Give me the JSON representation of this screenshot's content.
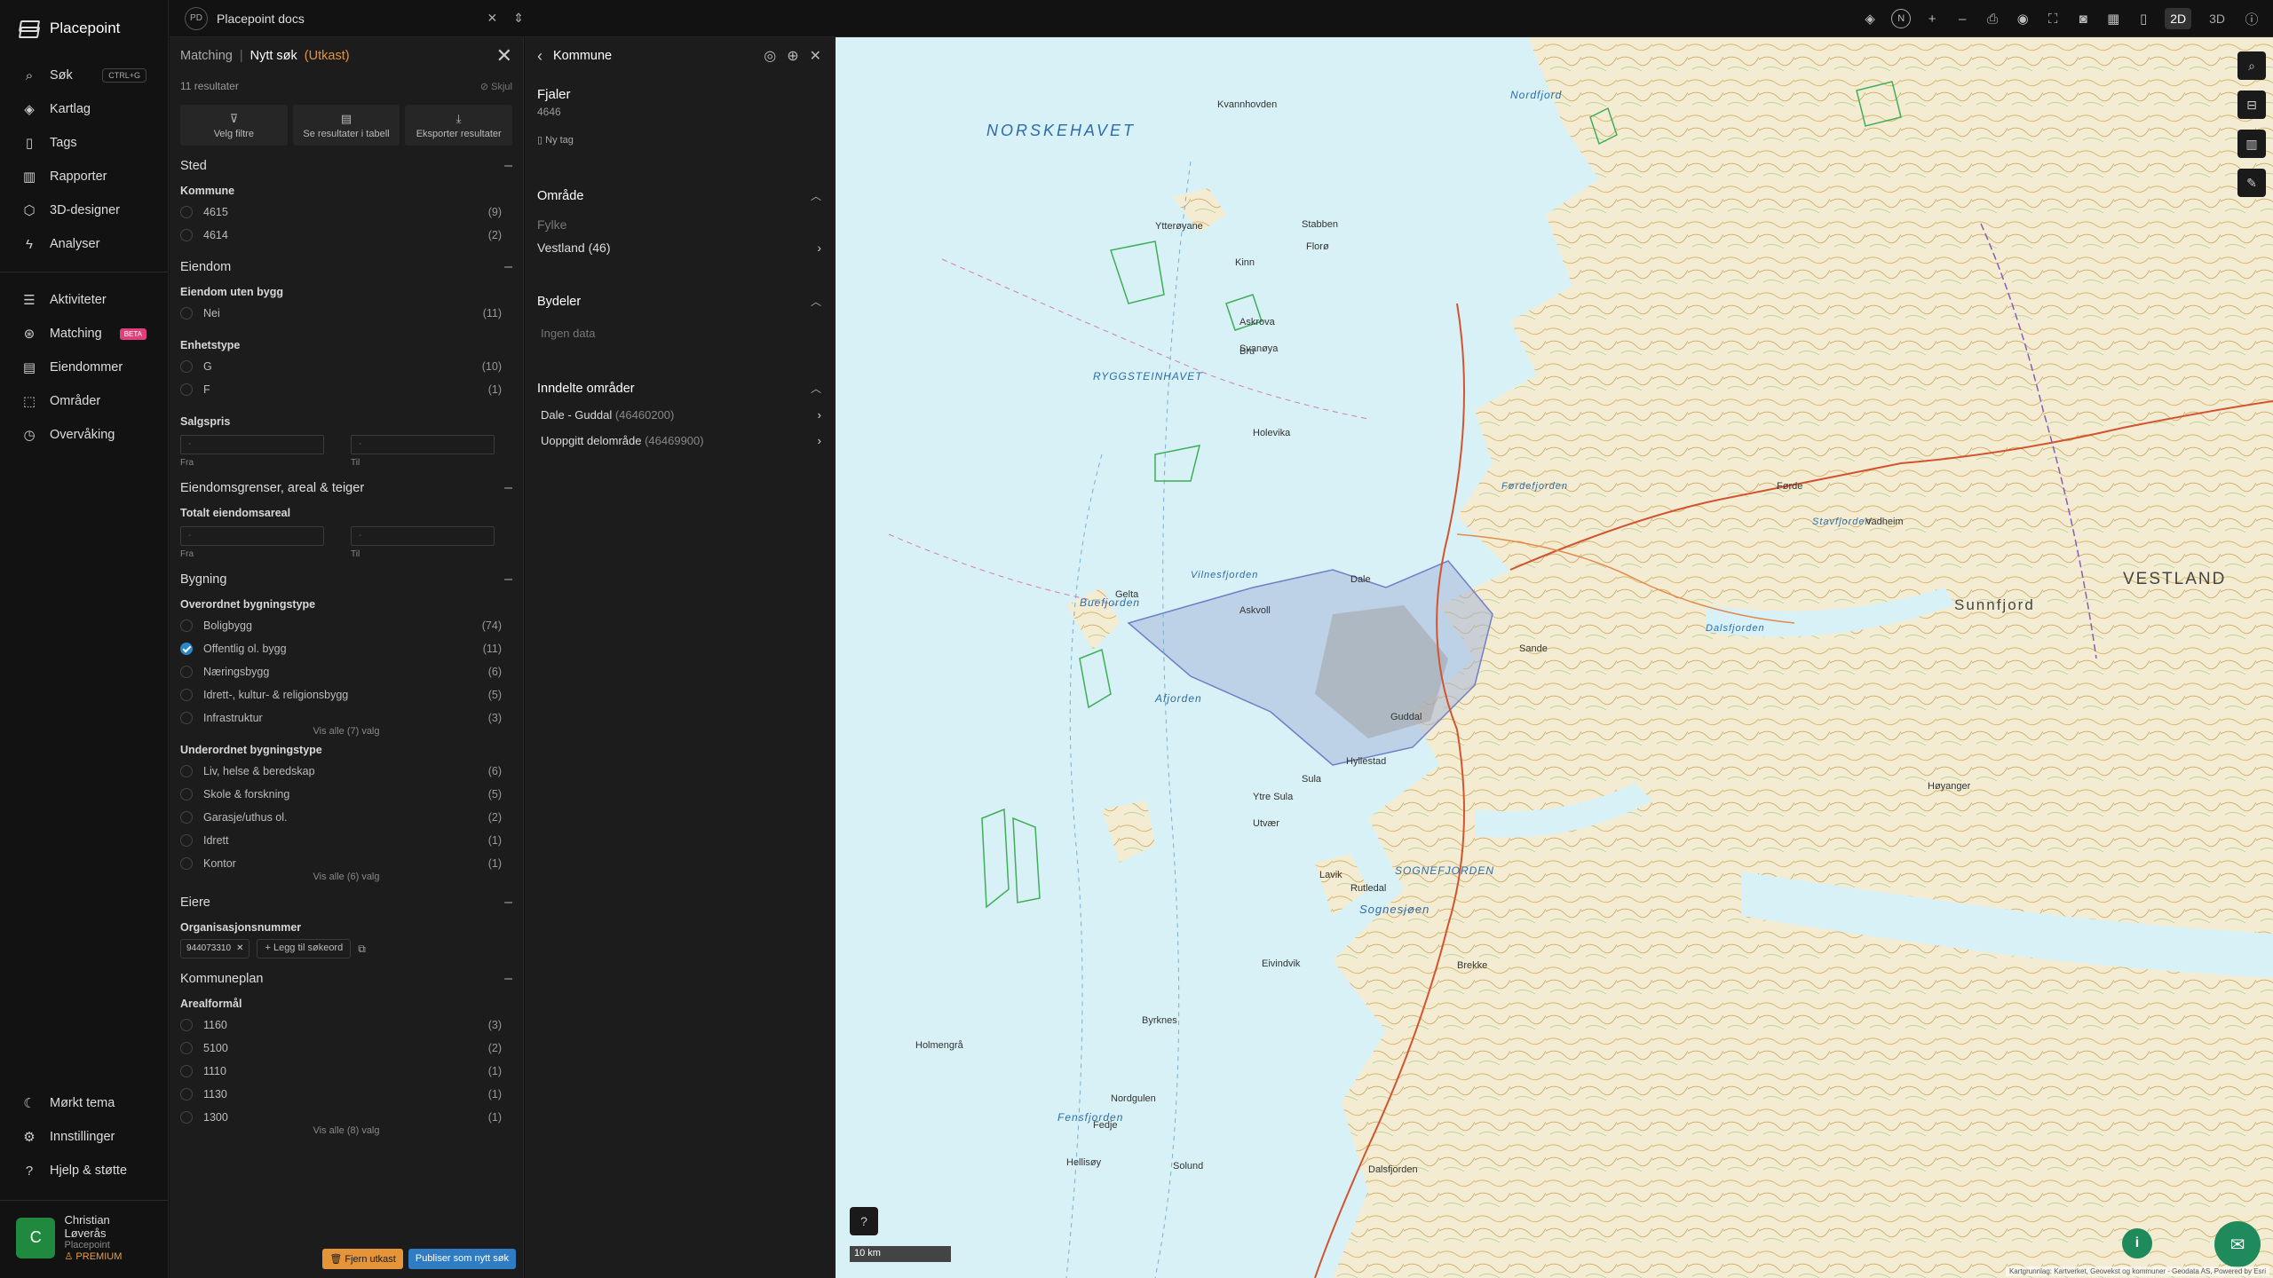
{
  "app": {
    "brand": "Placepoint",
    "project_badge": "PD",
    "project_name": "Placepoint docs"
  },
  "nav": {
    "items": [
      {
        "label": "Søk",
        "icon": "search-icon",
        "shortcut": "CTRL+G"
      },
      {
        "label": "Kartlag",
        "icon": "layers-icon"
      },
      {
        "label": "Tags",
        "icon": "bookmark-icon"
      },
      {
        "label": "Rapporter",
        "icon": "chart-icon"
      },
      {
        "label": "3D-designer",
        "icon": "cube-icon"
      },
      {
        "label": "Analyser",
        "icon": "bolt-icon"
      }
    ],
    "items2": [
      {
        "label": "Aktiviteter",
        "icon": "activity-icon"
      },
      {
        "label": "Matching",
        "icon": "matching-icon",
        "badge": "BETA"
      },
      {
        "label": "Eiendommer",
        "icon": "building-icon"
      },
      {
        "label": "Områder",
        "icon": "area-icon"
      },
      {
        "label": "Overvåking",
        "icon": "monitor-icon"
      }
    ],
    "bottom": [
      {
        "label": "Mørkt tema",
        "icon": "moon-icon"
      },
      {
        "label": "Innstillinger",
        "icon": "gear-icon"
      },
      {
        "label": "Hjelp & støtte",
        "icon": "help-icon"
      }
    ],
    "user": {
      "initial": "C",
      "name": "Christian Løverås",
      "org": "Placepoint",
      "tier": "PREMIUM"
    }
  },
  "topbar": {
    "compass": "N",
    "mode_2d": "2D",
    "mode_3d": "3D"
  },
  "filters": {
    "crumb": "Matching",
    "title": "Nytt søk",
    "draft": "(Utkast)",
    "results": "11 resultater",
    "hide": "Skjul",
    "actions": [
      "Velg filtre",
      "Se resultater i tabell",
      "Eksporter resultater"
    ],
    "sted": {
      "title": "Sted",
      "kommune_label": "Kommune",
      "options": [
        {
          "label": "4615",
          "count": "(9)"
        },
        {
          "label": "4614",
          "count": "(2)"
        }
      ]
    },
    "eiendom": {
      "title": "Eiendom",
      "uten_bygg_label": "Eiendom uten bygg",
      "uten_bygg": [
        {
          "label": "Nei",
          "count": "(11)"
        }
      ],
      "enhetstype_label": "Enhetstype",
      "enhetstype": [
        {
          "label": "G",
          "count": "(10)"
        },
        {
          "label": "F",
          "count": "(1)"
        }
      ],
      "salgspris_label": "Salgspris",
      "from_placeholder": "-",
      "to_placeholder": "-",
      "from": "Fra",
      "to": "Til"
    },
    "grenser": {
      "title": "Eiendomsgrenser, areal & teiger",
      "areal_label": "Totalt eiendomsareal",
      "from": "Fra",
      "to": "Til",
      "from_placeholder": "-",
      "to_placeholder": "-"
    },
    "bygning": {
      "title": "Bygning",
      "over_label": "Overordnet bygningstype",
      "over": [
        {
          "label": "Boligbygg",
          "count": "(74)",
          "checked": false
        },
        {
          "label": "Offentlig ol. bygg",
          "count": "(11)",
          "checked": true
        },
        {
          "label": "Næringsbygg",
          "count": "(6)",
          "checked": false
        },
        {
          "label": "Idrett-, kultur- & religionsbygg",
          "count": "(5)",
          "checked": false
        },
        {
          "label": "Infrastruktur",
          "count": "(3)",
          "checked": false
        }
      ],
      "over_more": "Vis alle (7) valg",
      "under_label": "Underordnet bygningstype",
      "under": [
        {
          "label": "Liv, helse & beredskap",
          "count": "(6)"
        },
        {
          "label": "Skole & forskning",
          "count": "(5)"
        },
        {
          "label": "Garasje/uthus ol.",
          "count": "(2)"
        },
        {
          "label": "Idrett",
          "count": "(1)"
        },
        {
          "label": "Kontor",
          "count": "(1)"
        }
      ],
      "under_more": "Vis alle (6) valg"
    },
    "eiere": {
      "title": "Eiere",
      "org_label": "Organisasjonsnummer",
      "chip": "944073310",
      "add": "Legg til søkeord"
    },
    "kommuneplan": {
      "title": "Kommuneplan",
      "areal_label": "Arealformål",
      "options": [
        {
          "label": "1160",
          "count": "(3)"
        },
        {
          "label": "5100",
          "count": "(2)"
        },
        {
          "label": "1110",
          "count": "(1)"
        },
        {
          "label": "1130",
          "count": "(1)"
        },
        {
          "label": "1300",
          "count": "(1)"
        }
      ],
      "more": "Vis alle (8) valg"
    },
    "footer": {
      "remove": "Fjern utkast",
      "publish": "Publiser som nytt søk"
    }
  },
  "kommune": {
    "title": "Kommune",
    "name": "Fjaler",
    "code": "4646",
    "tag": "Ny tag",
    "omrade": {
      "title": "Område",
      "fylke_label": "Fylke",
      "fylke_value": "Vestland (46)"
    },
    "bydeler": {
      "title": "Bydeler",
      "empty": "Ingen data"
    },
    "inndelte": {
      "title": "Inndelte områder",
      "items": [
        {
          "name": "Dale - Guddal",
          "code": "(46460200)"
        },
        {
          "name": "Uoppgitt delområde",
          "code": "(46469900)"
        }
      ]
    }
  },
  "map": {
    "sea_label": "NORSKEHAVET",
    "region_label": "VESTLAND",
    "district_label": "Sunnfjord",
    "fjord_labels": [
      "Nordfjord",
      "SOGNEFJORDEN",
      "Sognesjøen",
      "Fensfjorden",
      "Afjorden",
      "Buefjorden",
      "Vilnesfjorden",
      "Førdefjorden",
      "Dalsfjorden",
      "RYGGSTEINHAVET",
      "Stavfjorden"
    ],
    "place_labels": [
      "Kvannhovden",
      "Ytterøyane",
      "Kinn",
      "Florø",
      "Stabben",
      "Askrova",
      "Svanøya",
      "Bru",
      "Holevika",
      "Gelta",
      "Askvoll",
      "Dale",
      "Guddal",
      "Hyllestad",
      "Sula",
      "Ytre Sula",
      "Utvær",
      "Holmengrå",
      "Fedje",
      "Hellisøy",
      "Lavik",
      "Førde",
      "Sande",
      "Vadheim",
      "Høyanger",
      "Brekke",
      "Rutledal",
      "Eivindvik",
      "Byrknes",
      "Nordgulen",
      "Solund",
      "Dalsfjorden"
    ],
    "scale": "10 km",
    "attribution": "Kartgrunnlag: Kartverket, Geovekst og kommuner - Geodata AS, Powered by Esri"
  }
}
